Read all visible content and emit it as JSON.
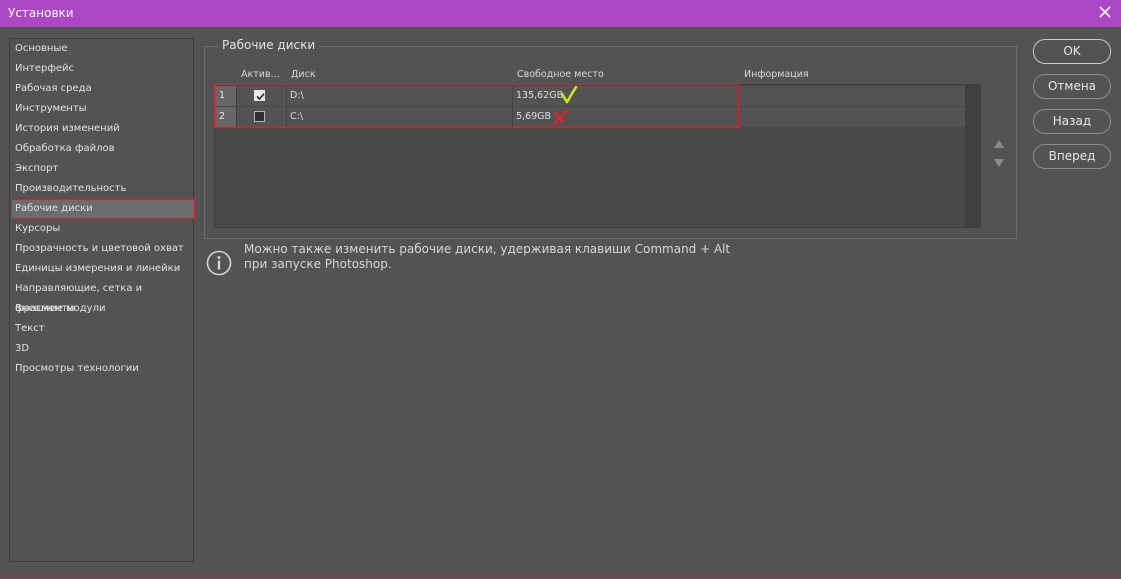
{
  "window": {
    "title": "Установки"
  },
  "sidebar": {
    "items": [
      {
        "label": "Основные"
      },
      {
        "label": "Интерфейс"
      },
      {
        "label": "Рабочая среда"
      },
      {
        "label": "Инструменты"
      },
      {
        "label": "История изменений"
      },
      {
        "label": "Обработка файлов"
      },
      {
        "label": "Экспорт"
      },
      {
        "label": "Производительность"
      },
      {
        "label": "Рабочие диски"
      },
      {
        "label": "Курсоры"
      },
      {
        "label": "Прозрачность и цветовой охват"
      },
      {
        "label": "Единицы измерения и линейки"
      },
      {
        "label": "Направляющие, сетка и фрагменты"
      },
      {
        "label": "Внешние модули"
      },
      {
        "label": "Текст"
      },
      {
        "label": "3D"
      },
      {
        "label": "Просмотры технологии"
      }
    ],
    "selected": "Рабочие диски"
  },
  "scratch_disks": {
    "group_title": "Рабочие диски",
    "columns": [
      "Актив...",
      "Диск",
      "Свободное место",
      "Информация"
    ],
    "rows": [
      {
        "num": "1",
        "active": true,
        "disk": "D:\\",
        "free": "135,62GB",
        "info": "",
        "mark": "check-mark-icon"
      },
      {
        "num": "2",
        "active": false,
        "disk": "C:\\",
        "free": "5,69GB",
        "info": "",
        "mark": "cross-mark-icon"
      }
    ]
  },
  "info": {
    "line1": "Можно также изменить рабочие диски, удерживая клавиши Command + Alt",
    "line2": "при запуске Photoshop."
  },
  "buttons": {
    "ok": "OK",
    "cancel": "Отмена",
    "back": "Назад",
    "forward": "Вперед"
  },
  "colors": {
    "titlebar": "#ad46c4",
    "panel": "#535353",
    "highlight": "#d4232b",
    "check_mark": "#c8e61e",
    "cross_mark": "#e8202a"
  }
}
